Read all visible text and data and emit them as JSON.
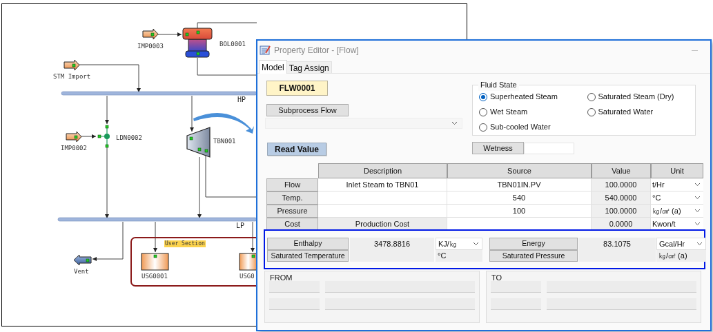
{
  "diagram": {
    "nodes": [
      {
        "kind": "import",
        "label": "IMP0003"
      },
      {
        "kind": "boiler",
        "label": "BOL0001"
      },
      {
        "kind": "import",
        "label": "STM Import"
      },
      {
        "kind": "valve",
        "label": "LDN0002"
      },
      {
        "kind": "import",
        "label": "IMP0002"
      },
      {
        "kind": "turbine",
        "label": "TBN001"
      },
      {
        "kind": "vent",
        "label": "Vent"
      },
      {
        "kind": "user",
        "label": "USG0001"
      },
      {
        "kind": "user",
        "label": "USG0"
      }
    ],
    "headers": [
      {
        "label": "HP"
      },
      {
        "label": "LP"
      }
    ],
    "section": {
      "label": "User Section"
    }
  },
  "editor": {
    "title": "Property Editor - [Flow]",
    "tabs": [
      {
        "label": "Model",
        "selected": true
      },
      {
        "label": "Tag Assign",
        "selected": false
      }
    ],
    "tag": "FLW0001",
    "subprocess_button": "Subprocess Flow",
    "fluid_state": {
      "title": "Fluid State",
      "options": [
        {
          "label": "Superheated Steam",
          "selected": true
        },
        {
          "label": "Saturated Steam (Dry)",
          "selected": false
        },
        {
          "label": "Wet Steam",
          "selected": false
        },
        {
          "label": "Saturated Water",
          "selected": false
        },
        {
          "label": "Sub-cooled Water",
          "selected": false
        }
      ]
    },
    "read_value_button": "Read Value",
    "wetness_button": "Wetness",
    "table": {
      "columns": [
        "Description",
        "Source",
        "Value",
        "Unit"
      ],
      "rows": [
        {
          "label": "Flow",
          "description": "Inlet Steam to TBN01",
          "source": "TBN01IN.PV",
          "value": "100.0000",
          "unit": "t/Hr",
          "description_readonly": false
        },
        {
          "label": "Temp.",
          "description": "",
          "source": "540",
          "value": "540.0000",
          "unit": "°C",
          "description_readonly": false
        },
        {
          "label": "Pressure",
          "description": "",
          "source": "100",
          "value": "100.0000",
          "unit": "㎏/㎠ (a)",
          "description_readonly": false
        },
        {
          "label": "Cost",
          "description": "Production Cost",
          "source": "",
          "value": "0.0000",
          "unit": "Kwon/t",
          "description_readonly": true
        }
      ]
    },
    "calculated": [
      {
        "label": "Enthalpy",
        "value": "3478.8816",
        "unit": "KJ/㎏",
        "unit_dropdown": true
      },
      {
        "label": "Energy",
        "value": "83.1075",
        "unit": "Gcal/Hr",
        "unit_dropdown": true
      },
      {
        "label": "Saturated Temperature",
        "unit": "°C",
        "unit_dropdown": false
      },
      {
        "label": "Saturated Pressure",
        "unit": "㎏/㎠ (a)",
        "unit_dropdown": false
      }
    ],
    "groups": [
      {
        "title": "FROM"
      },
      {
        "title": "TO"
      }
    ]
  }
}
